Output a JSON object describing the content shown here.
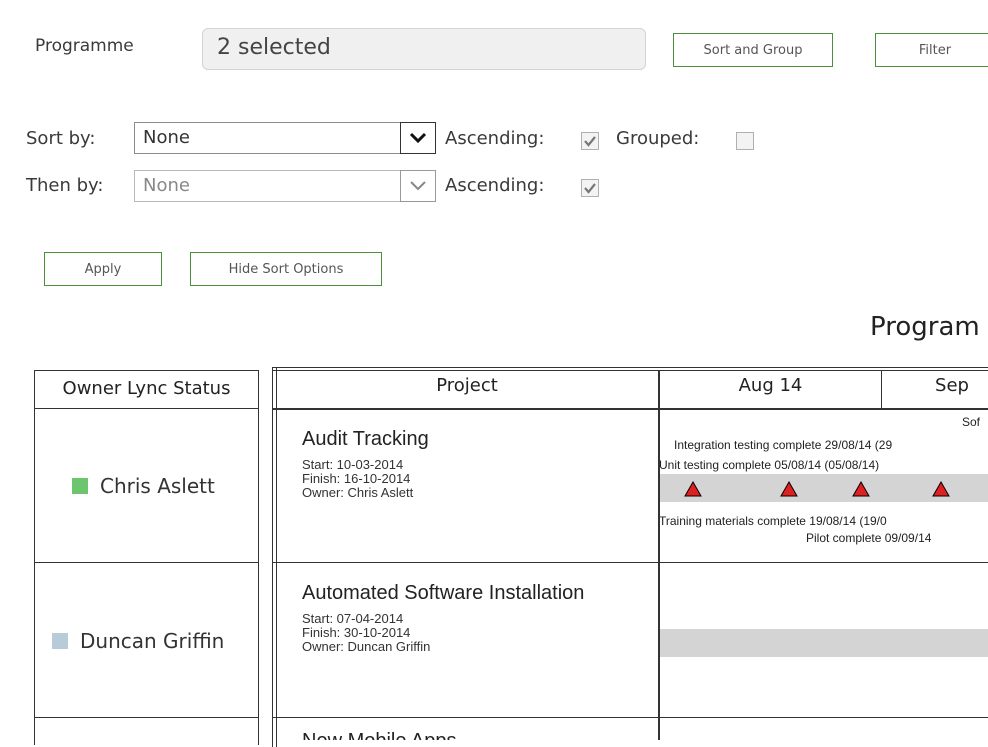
{
  "filter_bar": {
    "programme_label": "Programme",
    "programme_value": "2 selected",
    "sort_group_label": "Sort and Group",
    "filter_label": "Filter"
  },
  "sort_options": {
    "sort_by_label": "Sort by:",
    "sort_by_value": "None",
    "ascending_label": "Ascending:",
    "grouped_label": "Grouped:",
    "then_by_label": "Then by:",
    "then_by_value": "None",
    "ascending2_label": "Ascending:",
    "apply_label": "Apply",
    "hide_label": "Hide Sort Options"
  },
  "report": {
    "title": "Program"
  },
  "table": {
    "headers": {
      "owner": "Owner Lync Status",
      "project": "Project",
      "aug": "Aug 14",
      "sep": "Sep"
    },
    "rows": [
      {
        "owner": "Chris Aslett",
        "status_color": "#6dc66d",
        "project": "Audit Tracking",
        "start": "Start: 10-03-2014",
        "finish": "Finish: 16-10-2014",
        "owner_line": "Owner: Chris Aslett",
        "milestones": {
          "top_cut": "Sof",
          "integration": "Integration testing complete 29/08/14 (29",
          "unit": "Unit testing complete 05/08/14 (05/08/14)",
          "training": "Training materials complete 19/08/14 (19/0",
          "pilot": "Pilot complete 09/09/14"
        }
      },
      {
        "owner": "Duncan Griffin",
        "status_color": "#b8cbd8",
        "project": "Automated Software Installation",
        "start": "Start: 07-04-2014",
        "finish": "Finish: 30-10-2014",
        "owner_line": "Owner: Duncan Griffin"
      },
      {
        "project": "New Mobile Apps"
      }
    ]
  },
  "colors": {
    "button_border": "#4a8f3c",
    "milestone_red": "#e02020",
    "gantt_bar": "#d4d4d4"
  }
}
